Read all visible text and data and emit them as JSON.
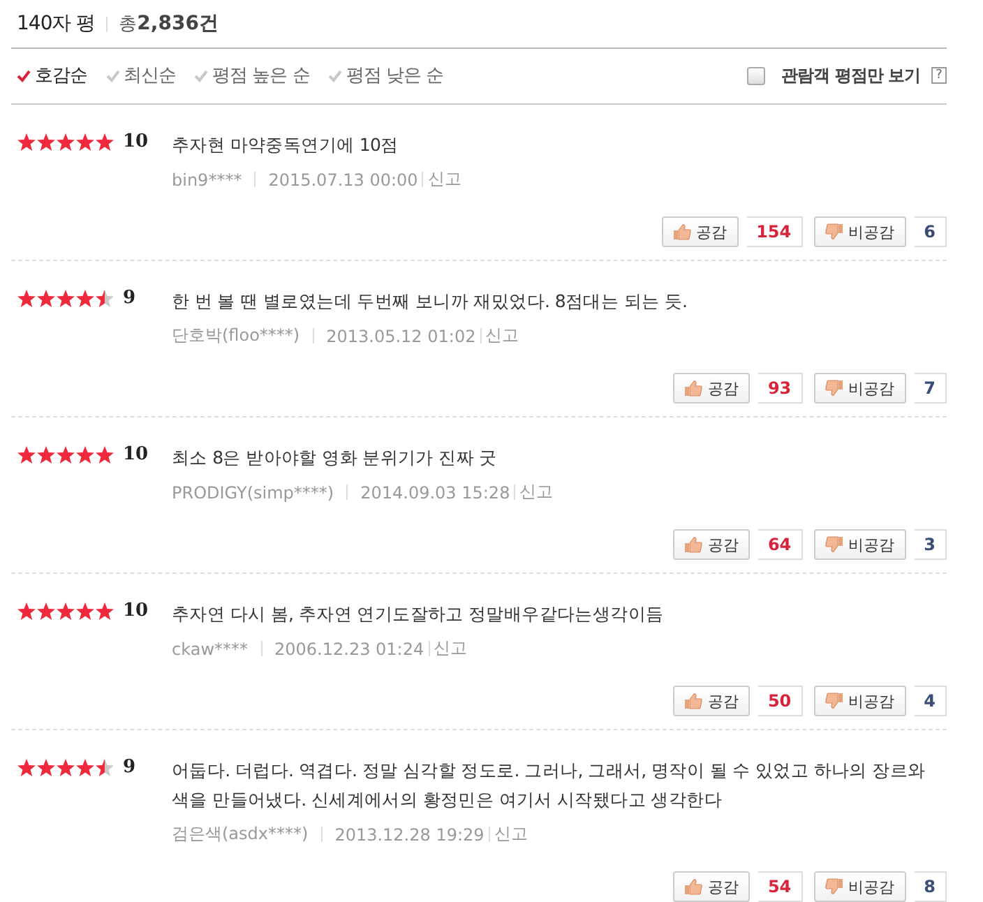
{
  "header": {
    "title": "140자 평",
    "total_prefix": "총",
    "total": "2,836건"
  },
  "sort_options": [
    {
      "label": "호감순",
      "selected": true
    },
    {
      "label": "최신순",
      "selected": false
    },
    {
      "label": "평점 높은 순",
      "selected": false
    },
    {
      "label": "평점 낮은 순",
      "selected": false
    }
  ],
  "audience_filter": {
    "label": "관람객 평점만 보기",
    "checked": false,
    "help": "?"
  },
  "reviews": [
    {
      "stars": 5,
      "score": "10",
      "text": "추자현 마약중독연기에 10점",
      "author": "bin9****",
      "date": "2015.07.13 00:00",
      "report": "신고",
      "like_label": "공감",
      "likes": "154",
      "dislike_label": "비공감",
      "dislikes": "6"
    },
    {
      "stars": 4.5,
      "score": "9",
      "text": "한 번 볼 땐 별로였는데 두번째 보니까 재밌었다. 8점대는 되는 듯.",
      "author": "단호박(floo****)",
      "date": "2013.05.12 01:02",
      "report": "신고",
      "like_label": "공감",
      "likes": "93",
      "dislike_label": "비공감",
      "dislikes": "7"
    },
    {
      "stars": 5,
      "score": "10",
      "text": "최소 8은 받아야할 영화 분위기가 진짜 굿",
      "author": "PRODIGY(simp****)",
      "date": "2014.09.03 15:28",
      "report": "신고",
      "like_label": "공감",
      "likes": "64",
      "dislike_label": "비공감",
      "dislikes": "3"
    },
    {
      "stars": 5,
      "score": "10",
      "text": "추자연 다시 봄, 추자연 연기도잘하고 정말배우같다는생각이듬",
      "author": "ckaw****",
      "date": "2006.12.23 01:24",
      "report": "신고",
      "like_label": "공감",
      "likes": "50",
      "dislike_label": "비공감",
      "dislikes": "4"
    },
    {
      "stars": 4.5,
      "score": "9",
      "text": "어둡다. 더럽다. 역겹다. 정말 심각할 정도로. 그러나, 그래서, 명작이 될 수 있었고 하나의 장르와 색을 만들어냈다. 신세계에서의 황정민은 여기서 시작됐다고 생각한다",
      "author": "검은색(asdx****)",
      "date": "2013.12.28 19:29",
      "report": "신고",
      "like_label": "공감",
      "likes": "54",
      "dislike_label": "비공감",
      "dislikes": "8"
    }
  ]
}
